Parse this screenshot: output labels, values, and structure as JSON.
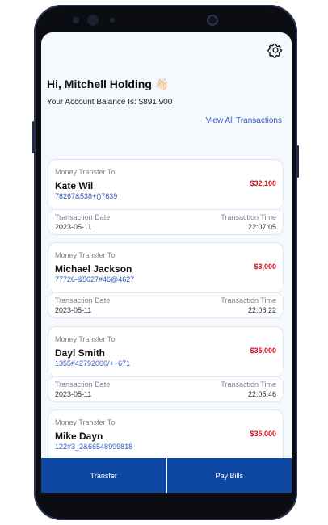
{
  "header": {
    "greeting": "Hi, Mitchell Holding",
    "emoji": "👋🏻",
    "balance_text": "Your Account Balance Is: $891,900",
    "view_all_label": "View All Transactions"
  },
  "transactions": [
    {
      "type_label": "Money Transfer To",
      "name": "Kate Wil",
      "account": "78267&538+()7639",
      "amount": "$32,100",
      "date_label": "Transaction Date",
      "date": "2023-05-11",
      "time_label": "Transaction Time",
      "time": "22:07:05"
    },
    {
      "type_label": "Money Transfer To",
      "name": "Michael Jackson",
      "account": "77726-&5627#46@4627",
      "amount": "$3,000",
      "date_label": "Transaction Date",
      "date": "2023-05-11",
      "time_label": "Transaction Time",
      "time": "22:06:22"
    },
    {
      "type_label": "Money Transfer To",
      "name": "Dayl Smith",
      "account": "1355#42792000/++671",
      "amount": "$35,000",
      "date_label": "Transaction Date",
      "date": "2023-05-11",
      "time_label": "Transaction Time",
      "time": "22:05:46"
    },
    {
      "type_label": "Money Transfer To",
      "name": "Mike Dayn",
      "account": "122#3_2&66548999818",
      "amount": "$35,000"
    }
  ],
  "nav": {
    "transfer_label": "Transfer",
    "pay_bills_label": "Pay Bills"
  },
  "icons": {
    "settings": "gear-icon"
  },
  "colors": {
    "accent": "#0d47a1",
    "link": "#2f5bbd",
    "amount": "#d10f1f"
  }
}
